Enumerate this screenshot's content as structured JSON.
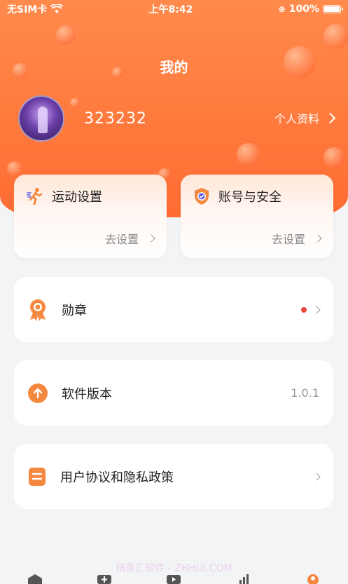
{
  "status_bar": {
    "carrier": "无SIM卡",
    "time": "上午8:42",
    "battery": "100%"
  },
  "header": {
    "title": "我的",
    "username": "323232",
    "profile_link": "个人资料"
  },
  "quick_cards": [
    {
      "title": "运动设置",
      "action": "去设置",
      "icon": "running-icon"
    },
    {
      "title": "账号与安全",
      "action": "去设置",
      "icon": "shield-icon"
    }
  ],
  "menu": [
    {
      "label": "勋章",
      "value": "",
      "icon": "medal-icon",
      "badge": true
    },
    {
      "label": "软件版本",
      "value": "1.0.1",
      "icon": "upload-arrow-icon"
    },
    {
      "label": "用户协议和隐私政策",
      "value": "",
      "icon": "document-icon"
    }
  ],
  "watermark": "精英汇软件 - ZHHUI.COM",
  "colors": {
    "accent": "#ff7a3d",
    "icon_orange": "#f5883f",
    "badge_red": "#e64840"
  },
  "tabbar": {
    "items": [
      "home-icon",
      "add-icon",
      "play-icon",
      "stats-icon",
      "profile-icon"
    ]
  }
}
